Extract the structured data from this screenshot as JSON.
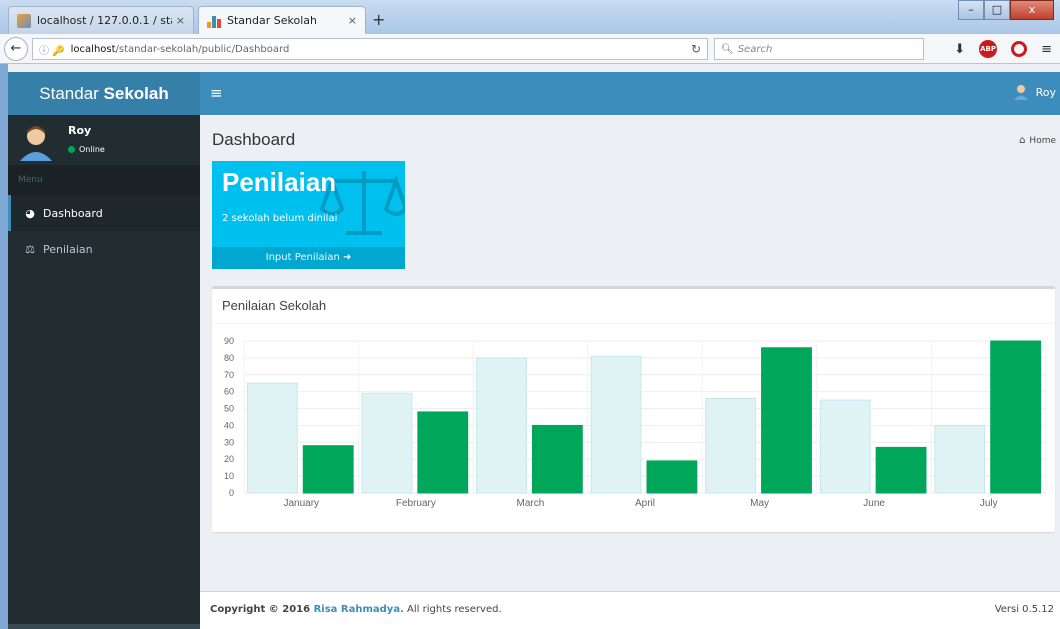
{
  "browser": {
    "tabs": [
      {
        "label": "localhost / 127.0.0.1 / stan...",
        "close": "×"
      },
      {
        "label": "Standar Sekolah",
        "close": "×"
      }
    ],
    "new_tab": "+",
    "url_host": "localhost",
    "url_path": "/standar-sekolah/public/Dashboard",
    "search_placeholder": "Search",
    "window_controls": {
      "minimize": "–",
      "maximize": "□",
      "close": "x"
    },
    "adblock_badge": "ABP"
  },
  "app": {
    "brand_regular": "Standar ",
    "brand_bold": "Sekolah",
    "top_user": "Roy"
  },
  "sidebar": {
    "user_name": "Roy",
    "user_status": "Online",
    "menu_header": "Menu",
    "items": [
      {
        "label": "Dashboard",
        "icon": "dashboard-icon",
        "active": true
      },
      {
        "label": "Penilaian",
        "icon": "balance-scale-icon",
        "active": false
      }
    ]
  },
  "content": {
    "page_title": "Dashboard",
    "breadcrumb": "Home",
    "small_box": {
      "title": "Penilaian",
      "description": "2 sekolah belum dinilai",
      "footer": "Input Penilaian",
      "color": "#00c0ef"
    },
    "card_title": "Penilaian Sekolah"
  },
  "chart_data": {
    "type": "bar",
    "categories": [
      "January",
      "February",
      "March",
      "April",
      "May",
      "June",
      "July"
    ],
    "series": [
      {
        "values": [
          65,
          59,
          80,
          81,
          56,
          55,
          40
        ],
        "color": "#dff3f5",
        "stroke": "#c5e8ec"
      },
      {
        "values": [
          28,
          48,
          40,
          19,
          86,
          27,
          90
        ],
        "color": "#00a65a",
        "stroke": "#00a65a"
      }
    ],
    "yticks": [
      0,
      10,
      20,
      30,
      40,
      50,
      60,
      70,
      80,
      90
    ],
    "ylim": [
      0,
      90
    ],
    "grid": true
  },
  "footer": {
    "copyright_prefix": "Copyright © 2016 ",
    "author": "Risa Rahmadya.",
    "rights": " All rights reserved.",
    "version": "Versi 0.5.12"
  }
}
